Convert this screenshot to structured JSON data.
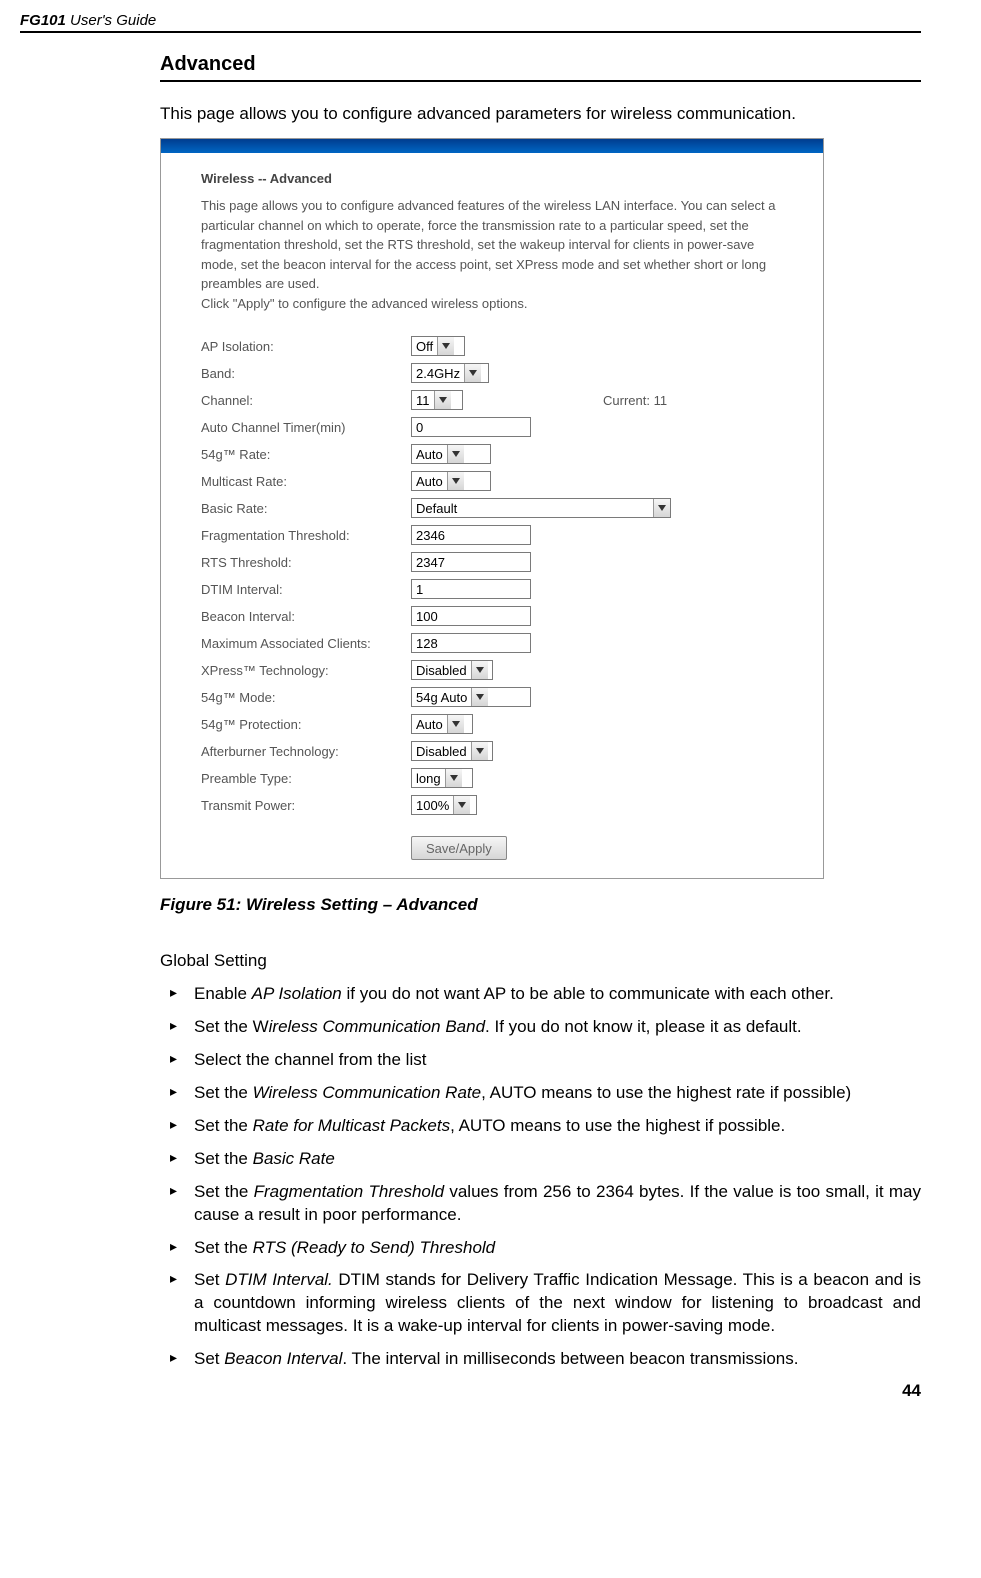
{
  "header": {
    "product": "FG101",
    "doc": " User's Guide"
  },
  "section_title": "Advanced",
  "intro_text": "This page allows you to configure advanced parameters for wireless communication.",
  "panel": {
    "title": "Wireless -- Advanced",
    "desc1": "This page allows you to configure advanced features of the wireless LAN interface. You can select a particular channel on which to operate, force the transmission rate to a particular speed, set the fragmentation threshold, set the RTS threshold, set the wakeup interval for clients in power-save mode, set the beacon interval for the access point, set XPress mode and set whether short or long preambles are used.",
    "desc2": "Click \"Apply\" to configure the advanced wireless options.",
    "rows": {
      "ap_isolation": {
        "label": "AP Isolation:",
        "value": "Off"
      },
      "band": {
        "label": "Band:",
        "value": "2.4GHz"
      },
      "channel": {
        "label": "Channel:",
        "value": "11",
        "current_label": "Current: 11"
      },
      "auto_timer": {
        "label": "Auto Channel Timer(min)",
        "value": "0"
      },
      "rate54g": {
        "label": "54g™ Rate:",
        "value": "Auto"
      },
      "multicast": {
        "label": "Multicast Rate:",
        "value": "Auto"
      },
      "basic_rate": {
        "label": "Basic Rate:",
        "value": "Default"
      },
      "frag": {
        "label": "Fragmentation Threshold:",
        "value": "2346"
      },
      "rts": {
        "label": "RTS Threshold:",
        "value": "2347"
      },
      "dtim": {
        "label": "DTIM Interval:",
        "value": "1"
      },
      "beacon": {
        "label": "Beacon Interval:",
        "value": "100"
      },
      "max_clients": {
        "label": "Maximum Associated Clients:",
        "value": "128"
      },
      "xpress": {
        "label": "XPress™ Technology:",
        "value": "Disabled"
      },
      "mode54g": {
        "label": "54g™ Mode:",
        "value": "54g Auto"
      },
      "prot54g": {
        "label": "54g™ Protection:",
        "value": "Auto"
      },
      "afterburner": {
        "label": "Afterburner Technology:",
        "value": "Disabled"
      },
      "preamble": {
        "label": "Preamble Type:",
        "value": "long"
      },
      "txpower": {
        "label": "Transmit Power:",
        "value": "100%"
      }
    },
    "save_button": "Save/Apply"
  },
  "figure_caption": "Figure 51: Wireless Setting – Advanced",
  "subhead": "Global Setting",
  "bullets": {
    "b1a": "Enable ",
    "b1i": "AP Isolation",
    "b1b": " if you do not want AP to be able to communicate with each other.",
    "b2a": "Set the W",
    "b2i": "ireless Communication Band",
    "b2b": ". If you do not know it, please it as default.",
    "b3": "Select the channel from the list",
    "b4a": "Set the ",
    "b4i": "Wireless Communication Rate",
    "b4b": ", AUTO means to use the highest rate if possible)",
    "b5a": "Set the ",
    "b5i": "Rate for Multicast Packets",
    "b5b": ", AUTO means to use the highest if possible.",
    "b6a": "Set the ",
    "b6i": "Basic Rate",
    "b7a": "Set the ",
    "b7i": "Fragmentation Threshold",
    "b7b": " values from 256 to 2364 bytes. If the value is too small, it may cause a result in poor performance.",
    "b8a": "Set the ",
    "b8i": "RTS (Ready to Send) Threshold",
    "b9a": "Set ",
    "b9i": "DTIM Interval.",
    "b9b": " DTIM stands for Delivery Traffic Indication Message. This is a beacon and is a countdown informing wireless clients of the next window for listening to broadcast and multicast messages. It is a wake-up interval for clients in power-saving mode.",
    "b10a": "Set ",
    "b10i": "Beacon Interval",
    "b10b": ". The interval in milliseconds between beacon transmissions."
  },
  "page_number": "44"
}
